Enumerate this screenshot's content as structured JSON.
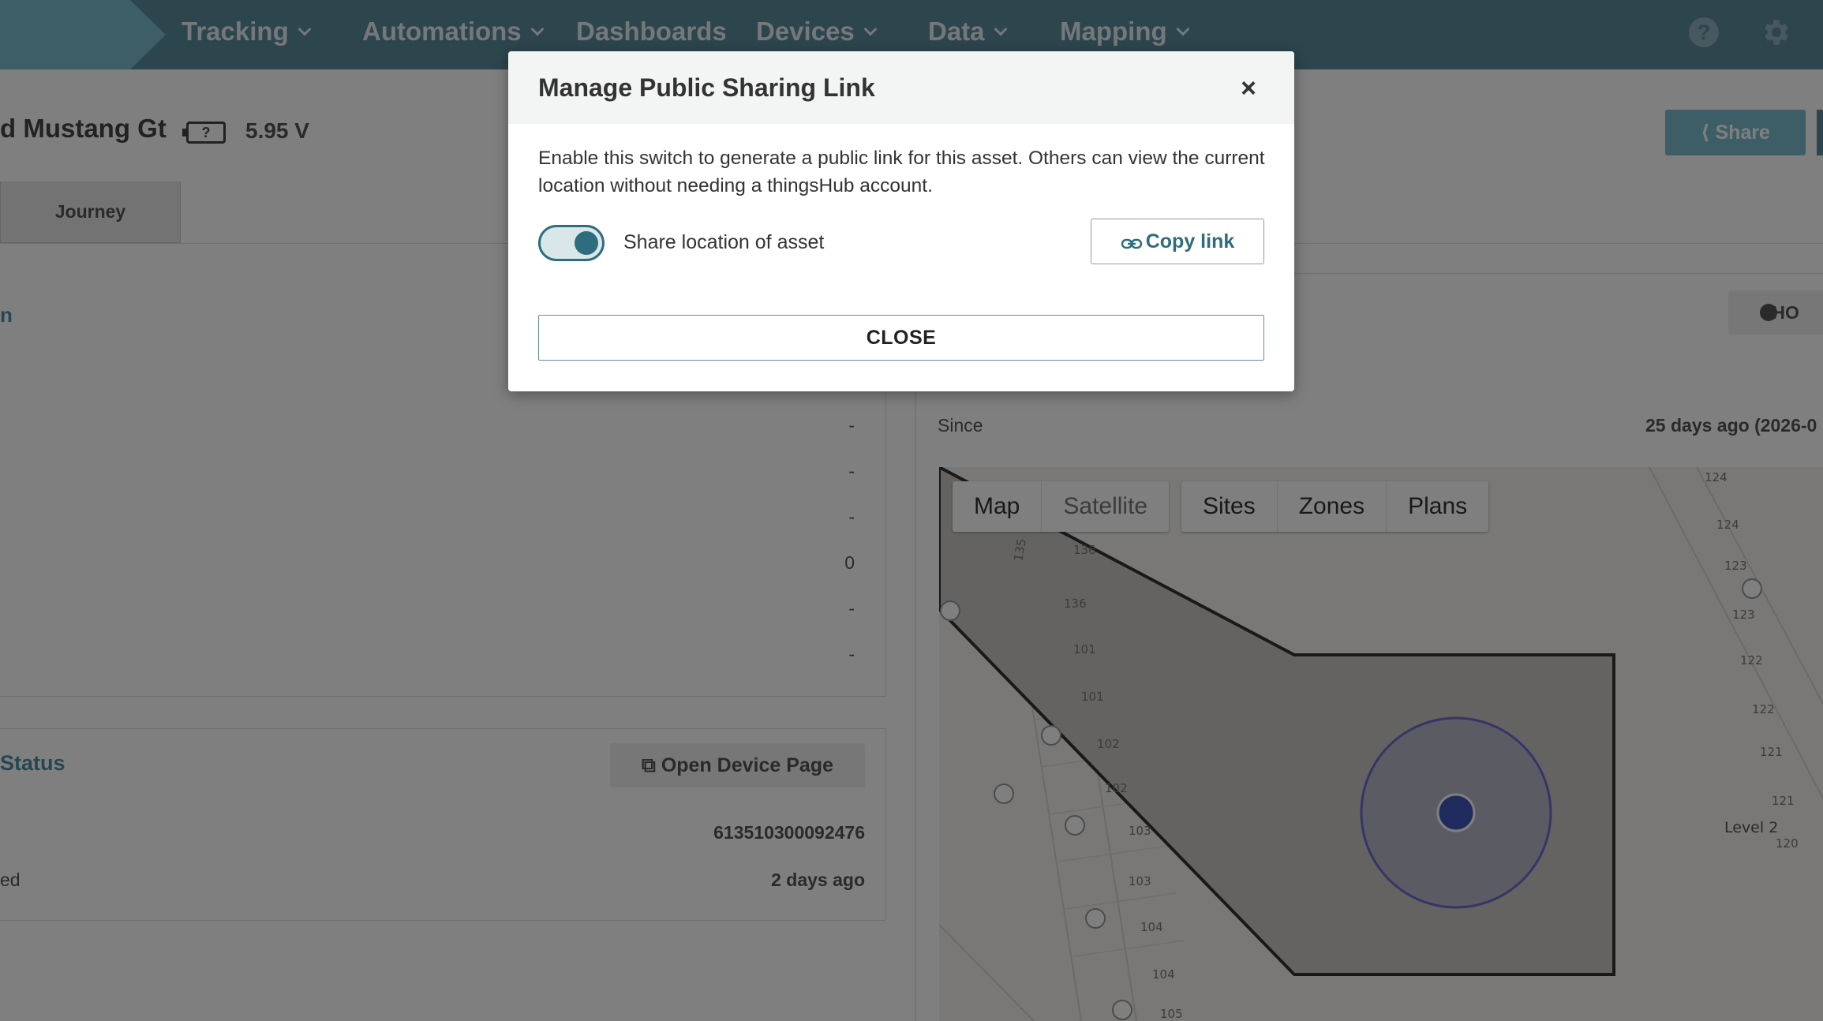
{
  "nav": {
    "items": [
      {
        "label": "Tracking",
        "dropdown": true
      },
      {
        "label": "Automations",
        "dropdown": true
      },
      {
        "label": "Dashboards",
        "dropdown": false
      },
      {
        "label": "Devices",
        "dropdown": true
      },
      {
        "label": "Data",
        "dropdown": true
      },
      {
        "label": "Mapping",
        "dropdown": true
      }
    ],
    "help_symbol": "?"
  },
  "asset": {
    "title": "d Mustang Gt",
    "battery_symbol": "?",
    "voltage": "5.95 V",
    "share_label": "Share"
  },
  "tabs": {
    "journey": "Journey"
  },
  "left_panel": {
    "heading_fragment": "n",
    "values": [
      "-",
      "-",
      "-",
      "0",
      "-",
      "-"
    ]
  },
  "status_panel": {
    "title": "Status",
    "open_device_label": "Open Device Page",
    "serial": "613510300092476",
    "row_label_fragment": "ed",
    "last_seen": "2 days ago"
  },
  "right_panel": {
    "show_label": "SHO",
    "since_label": "Since",
    "since_value": "25 days ago  (2026-0"
  },
  "map": {
    "type_buttons": [
      "Map",
      "Satellite"
    ],
    "layer_buttons": [
      "Sites",
      "Zones",
      "Plans"
    ],
    "level_label": "Level 2",
    "room_numbers": [
      "135",
      "136",
      "136",
      "101",
      "101",
      "102",
      "102",
      "103",
      "103",
      "104",
      "104",
      "105",
      "124",
      "124",
      "123",
      "123",
      "122",
      "122",
      "121",
      "121",
      "120"
    ]
  },
  "modal": {
    "title": "Manage Public Sharing Link",
    "close_symbol": "×",
    "description": "Enable this switch to generate a public link for this asset. Others can view the current location without needing a thingsHub account.",
    "toggle_label": "Share location of asset",
    "toggle_on": true,
    "copy_link_label": "Copy link",
    "close_button_label": "CLOSE"
  },
  "colors": {
    "nav_bg": "#5a8a9a",
    "accent": "#2e6d7d",
    "brand_light": "#7dbdcf"
  }
}
